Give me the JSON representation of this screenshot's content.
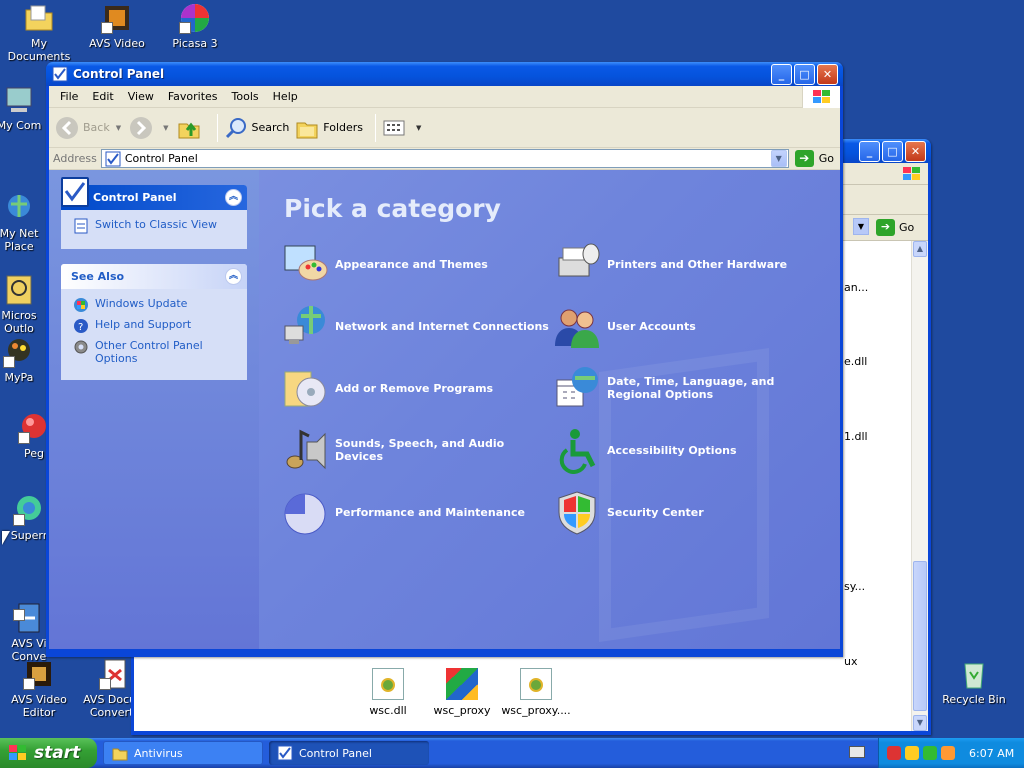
{
  "desktop": {
    "icons": [
      {
        "label": "My Documents",
        "icon": "my-documents-icon"
      },
      {
        "label": "AVS Video ReMaker",
        "icon": "avs-video-remaker-icon"
      },
      {
        "label": "Picasa 3",
        "icon": "picasa-icon"
      },
      {
        "label": "My Com",
        "icon": "my-computer-icon"
      },
      {
        "label": "My Net\nPlace",
        "icon": "my-network-places-icon"
      },
      {
        "label": "Micros\nOutlo",
        "icon": "outlook-icon"
      },
      {
        "label": "MyPa",
        "icon": "mypaint-icon"
      },
      {
        "label": "Peg",
        "icon": "pegasus-icon"
      },
      {
        "label": "Superr",
        "icon": "super-icon"
      },
      {
        "label": "AVS Vi\nConve",
        "icon": "avs-video-converter-icon"
      },
      {
        "label": "AVS Video Editor",
        "icon": "avs-video-editor-icon"
      },
      {
        "label": "AVS Docum Converte",
        "icon": "avs-document-converter-icon"
      },
      {
        "label": "Recycle Bin",
        "icon": "recycle-bin-icon"
      }
    ]
  },
  "back_window": {
    "title": "Antivirus",
    "go_label": "Go",
    "partial_labels": [
      "an...",
      "e.dll",
      "1.dll",
      "sy...",
      "ux"
    ],
    "files": [
      {
        "name": "wsc.dll",
        "icon": "dll-file-icon"
      },
      {
        "name": "wsc_proxy",
        "icon": "avg-app-icon"
      },
      {
        "name": "wsc_proxy....",
        "icon": "dll-file-icon"
      }
    ]
  },
  "cp_window": {
    "title": "Control Panel",
    "menu": [
      "File",
      "Edit",
      "View",
      "Favorites",
      "Tools",
      "Help"
    ],
    "toolbar": {
      "back": "Back",
      "search": "Search",
      "folders": "Folders"
    },
    "address": {
      "label": "Address",
      "value": "Control Panel",
      "go": "Go"
    },
    "sidebar": {
      "control_panel_title": "Control Panel",
      "switch_view": "Switch to Classic View",
      "see_also_title": "See Also",
      "see_also": [
        {
          "label": "Windows Update",
          "icon": "windows-update-icon"
        },
        {
          "label": "Help and Support",
          "icon": "help-icon"
        },
        {
          "label": "Other Control Panel Options",
          "icon": "gear-icon"
        }
      ]
    },
    "main": {
      "heading": "Pick a category",
      "categories": [
        {
          "label": "Appearance and Themes",
          "icon": "appearance-themes-icon"
        },
        {
          "label": "Printers and Other Hardware",
          "icon": "printer-icon"
        },
        {
          "label": "Network and Internet Connections",
          "icon": "network-icon"
        },
        {
          "label": "User Accounts",
          "icon": "user-accounts-icon"
        },
        {
          "label": "Add or Remove Programs",
          "icon": "add-remove-programs-icon"
        },
        {
          "label": "Date, Time, Language, and Regional Options",
          "icon": "date-time-icon"
        },
        {
          "label": "Sounds, Speech, and Audio Devices",
          "icon": "sound-icon"
        },
        {
          "label": "Accessibility Options",
          "icon": "accessibility-icon"
        },
        {
          "label": "Performance and Maintenance",
          "icon": "performance-icon"
        },
        {
          "label": "Security Center",
          "icon": "shield-icon"
        }
      ]
    }
  },
  "taskbar": {
    "start_label": "start",
    "tasks": [
      {
        "label": "Antivirus",
        "state": "inactive"
      },
      {
        "label": "Control Panel",
        "state": "active"
      }
    ],
    "clock": "6:07 AM"
  },
  "colors": {
    "desktop": "#1f4a9f",
    "cp_category_area": "#6e84dc",
    "sidebar_link": "#215dc6",
    "titlebar": "#0553dc"
  }
}
